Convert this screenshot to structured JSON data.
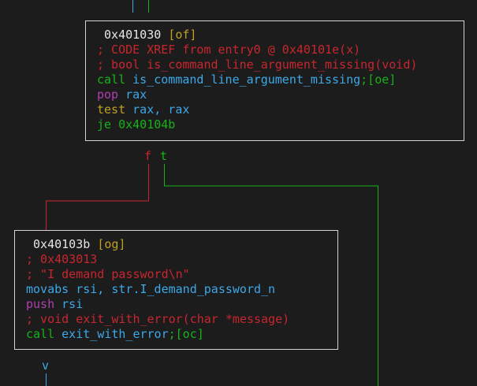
{
  "node_of": {
    "address": "0x401030",
    "label": "[of]",
    "xref_comment": "; CODE XREF from entry0 @ 0x40101e(x)",
    "signature_comment": "; bool is_command_line_argument_missing(void)",
    "call_mnemonic": "call",
    "call_target": "is_command_line_argument_missing",
    "call_ref": ";[oe]",
    "pop_mnemonic": "pop",
    "pop_operand": "rax",
    "test_mnemonic": "test",
    "test_operands": "rax, rax",
    "je_mnemonic": "je",
    "je_target": "0x40104b"
  },
  "branch": {
    "false_label": "f",
    "true_label": "t"
  },
  "node_og": {
    "address": "0x40103b",
    "label": "[og]",
    "addr_comment": "; 0x403013",
    "string_comment": "; \"I demand password\\n\"",
    "movabs_mnemonic": "movabs",
    "movabs_operands": "rsi, str.I_demand_password_n",
    "push_mnemonic": "push",
    "push_operand": "rsi",
    "signature_comment": "; void exit_with_error(char *message)",
    "call_mnemonic": "call",
    "call_target": "exit_with_error",
    "call_ref": ";[oc]"
  },
  "flow": {
    "down_marker": "v"
  },
  "colors": {
    "background": "#1c1c1c",
    "border": "#d4d4d4",
    "comment": "#c8262e",
    "mnemonic_green": "#18b218",
    "symbol_blue": "#3da8e8",
    "stack_magenta": "#b03fb0",
    "label_yellow": "#c0a020",
    "edge_false": "#c8262e",
    "edge_true": "#18b218",
    "edge_flow": "#3da8e8"
  }
}
